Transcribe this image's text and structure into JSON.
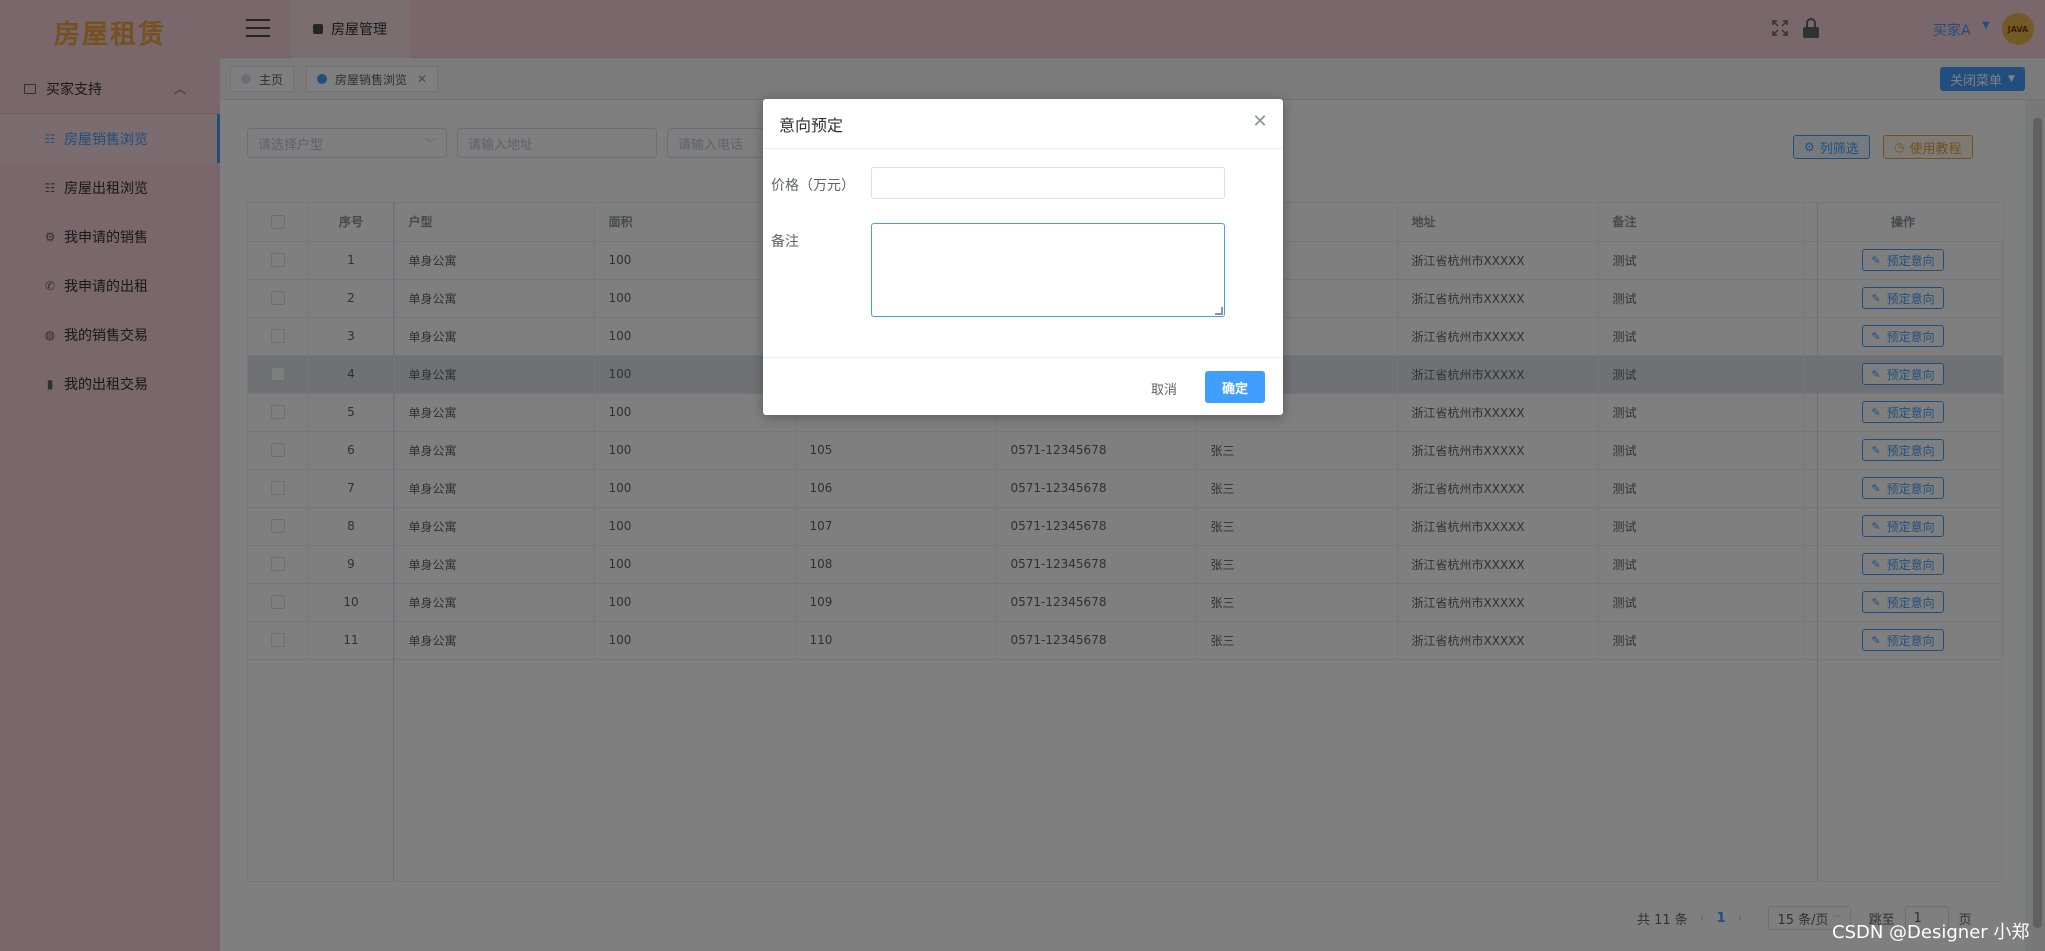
{
  "app": {
    "logo_text": "房屋租赁"
  },
  "sidebar": {
    "group_label": "买家支持",
    "items": [
      {
        "label": "房屋销售浏览",
        "icon": "grid-icon",
        "active": true
      },
      {
        "label": "房屋出租浏览",
        "icon": "grid-icon",
        "active": false
      },
      {
        "label": "我申请的销售",
        "icon": "settings-icon",
        "active": false
      },
      {
        "label": "我申请的出租",
        "icon": "phone-icon",
        "active": false
      },
      {
        "label": "我的销售交易",
        "icon": "globe-icon",
        "active": false
      },
      {
        "label": "我的出租交易",
        "icon": "delete-icon",
        "active": false
      }
    ]
  },
  "header": {
    "tab_label": "房屋管理",
    "user_name": "买家A",
    "avatar_text": "JAVA"
  },
  "tags": {
    "home": "主页",
    "current": "房屋销售浏览",
    "close_menu": "关闭菜单"
  },
  "filters": {
    "house_type_placeholder": "请选择户型",
    "address_placeholder": "请输入地址",
    "phone_placeholder": "请输入电话"
  },
  "toolbar": {
    "columns_label": "列筛选",
    "tutorial_label": "使用教程"
  },
  "table": {
    "headers": [
      "序号",
      "户型",
      "面积",
      "",
      "",
      "",
      "地址",
      "备注",
      "操作"
    ],
    "action_label": "预定意向",
    "rows": [
      {
        "no": "1",
        "type": "单身公寓",
        "area": "100",
        "c4": "",
        "phone": "",
        "owner": "",
        "address": "浙江省杭州市XXXXX",
        "note": "测试"
      },
      {
        "no": "2",
        "type": "单身公寓",
        "area": "100",
        "c4": "",
        "phone": "",
        "owner": "",
        "address": "浙江省杭州市XXXXX",
        "note": "测试"
      },
      {
        "no": "3",
        "type": "单身公寓",
        "area": "100",
        "c4": "",
        "phone": "",
        "owner": "",
        "address": "浙江省杭州市XXXXX",
        "note": "测试"
      },
      {
        "no": "4",
        "type": "单身公寓",
        "area": "100",
        "c4": "",
        "phone": "",
        "owner": "",
        "address": "浙江省杭州市XXXXX",
        "note": "测试"
      },
      {
        "no": "5",
        "type": "单身公寓",
        "area": "100",
        "c4": "",
        "phone": "",
        "owner": "",
        "address": "浙江省杭州市XXXXX",
        "note": "测试"
      },
      {
        "no": "6",
        "type": "单身公寓",
        "area": "100",
        "c4": "105",
        "phone": "0571-12345678",
        "owner": "张三",
        "address": "浙江省杭州市XXXXX",
        "note": "测试"
      },
      {
        "no": "7",
        "type": "单身公寓",
        "area": "100",
        "c4": "106",
        "phone": "0571-12345678",
        "owner": "张三",
        "address": "浙江省杭州市XXXXX",
        "note": "测试"
      },
      {
        "no": "8",
        "type": "单身公寓",
        "area": "100",
        "c4": "107",
        "phone": "0571-12345678",
        "owner": "张三",
        "address": "浙江省杭州市XXXXX",
        "note": "测试"
      },
      {
        "no": "9",
        "type": "单身公寓",
        "area": "100",
        "c4": "108",
        "phone": "0571-12345678",
        "owner": "张三",
        "address": "浙江省杭州市XXXXX",
        "note": "测试"
      },
      {
        "no": "10",
        "type": "单身公寓",
        "area": "100",
        "c4": "109",
        "phone": "0571-12345678",
        "owner": "张三",
        "address": "浙江省杭州市XXXXX",
        "note": "测试"
      },
      {
        "no": "11",
        "type": "单身公寓",
        "area": "100",
        "c4": "110",
        "phone": "0571-12345678",
        "owner": "张三",
        "address": "浙江省杭州市XXXXX",
        "note": "测试"
      }
    ]
  },
  "pagination": {
    "total": "共 11 条",
    "current_page": "1",
    "page_size": "15 条/页",
    "jump_label": "跳至",
    "jump_value": "1",
    "page_suffix": "页"
  },
  "dialog": {
    "title": "意向预定",
    "price_label": "价格（万元）",
    "note_label": "备注",
    "cancel_label": "取消",
    "ok_label": "确定"
  },
  "watermark": "CSDN @Designer 小郑",
  "colors": {
    "sidebar_bg": "#f4cfd8",
    "primary": "#409eff",
    "logo": "#e8a23e",
    "warning": "#e6a23c"
  }
}
